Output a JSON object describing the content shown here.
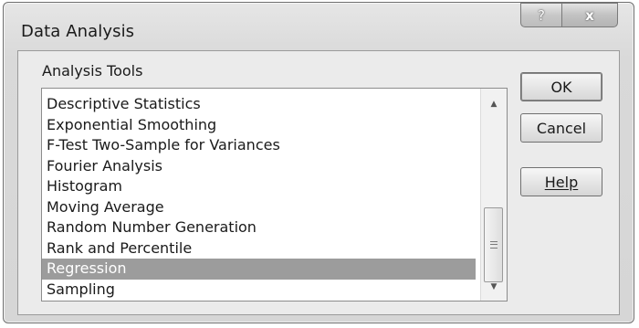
{
  "window": {
    "title": "Data Analysis",
    "help_icon": "?",
    "close_icon": "x"
  },
  "group": {
    "label": "Analysis Tools"
  },
  "list": {
    "items": [
      {
        "label": "Descriptive Statistics",
        "selected": false
      },
      {
        "label": "Exponential Smoothing",
        "selected": false
      },
      {
        "label": "F-Test Two-Sample for Variances",
        "selected": false
      },
      {
        "label": "Fourier Analysis",
        "selected": false
      },
      {
        "label": "Histogram",
        "selected": false
      },
      {
        "label": "Moving Average",
        "selected": false
      },
      {
        "label": "Random Number Generation",
        "selected": false
      },
      {
        "label": "Rank and Percentile",
        "selected": false
      },
      {
        "label": "Regression",
        "selected": true
      },
      {
        "label": "Sampling",
        "selected": false
      }
    ],
    "selected_index": 8,
    "scroll_up_icon": "▲",
    "scroll_down_icon": "▼"
  },
  "buttons": {
    "ok": "OK",
    "cancel": "Cancel",
    "help": "Help"
  },
  "colors": {
    "selection": "#9c9c9c",
    "dialog_background": "#ebebeb"
  }
}
